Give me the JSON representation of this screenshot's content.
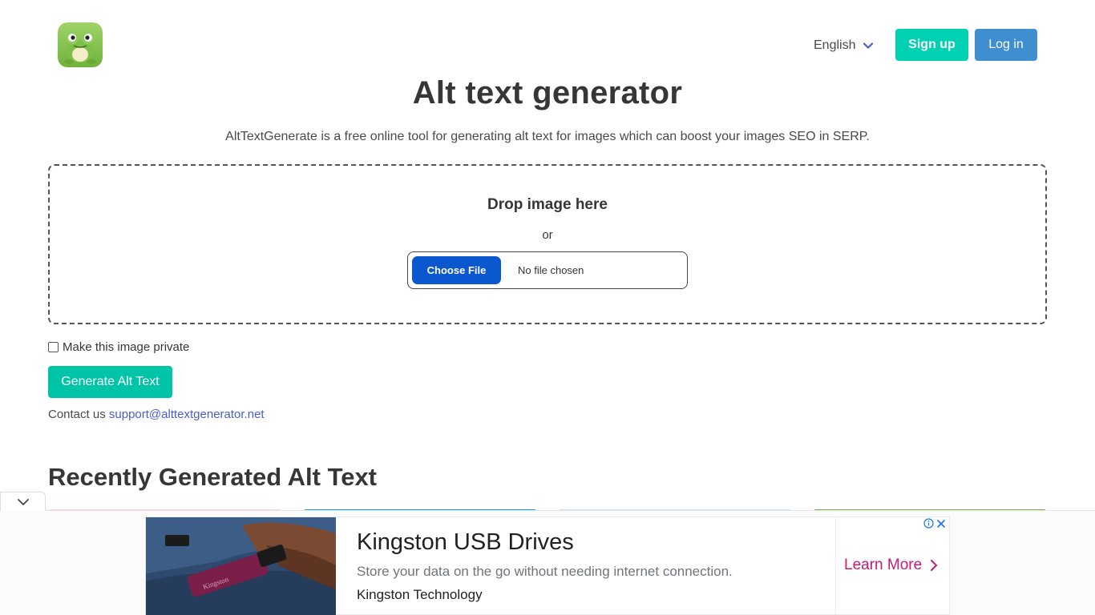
{
  "header": {
    "language": "English",
    "signup_label": "Sign up",
    "login_label": "Log in"
  },
  "hero": {
    "title": "Alt text generator",
    "subtitle": "AltTextGenerate is a free online tool for generating alt text for images which can boost your images SEO in SERP."
  },
  "upload": {
    "drop_label": "Drop image here",
    "or_label": "or",
    "choose_file_label": "Choose File",
    "file_status": "No file chosen"
  },
  "options": {
    "private_label": "Make this image private"
  },
  "generate_label": "Generate Alt Text",
  "contact": {
    "prefix": "Contact us",
    "email": "support@alttextgenerator.net"
  },
  "recent": {
    "heading": "Recently Generated Alt Text"
  },
  "ad": {
    "title": "Kingston USB Drives",
    "description": "Store your data on the go without needing internet connection.",
    "brand": "Kingston Technology",
    "cta": "Learn More",
    "image_text": "Kingston"
  },
  "colors": {
    "signup": "#00d1b2",
    "login": "#3e8ed0",
    "generate": "#00c4a7",
    "choose_file": "#0b57d0",
    "link": "#485fc7",
    "ad_cta": "#c41a78"
  }
}
